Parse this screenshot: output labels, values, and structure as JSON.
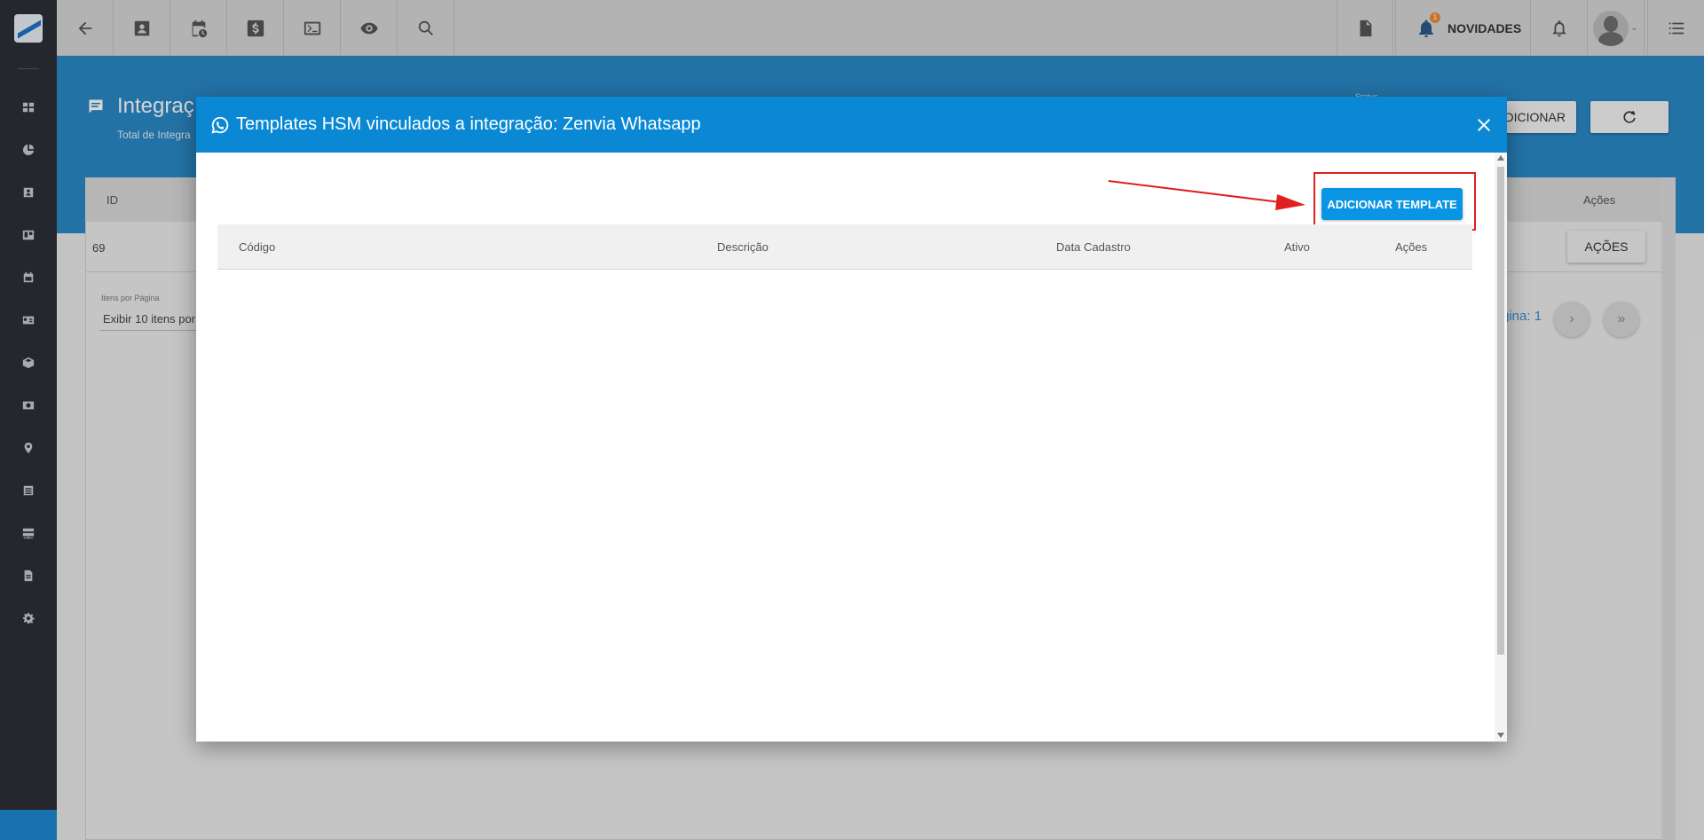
{
  "topbar": {
    "buttons": [
      "back-arrow-icon",
      "contact-card-icon",
      "calendar-clock-icon",
      "dollar-icon",
      "terminal-icon",
      "eye-icon",
      "search-icon"
    ],
    "right": {
      "novidades_label": "NOVIDADES",
      "badge_count": "1"
    }
  },
  "sidebar": {
    "items": [
      "dashboard-icon",
      "pie-chart-icon",
      "contact-icon",
      "board-icon",
      "calendar-icon",
      "id-card-icon",
      "box-icon",
      "money-icon",
      "location-icon",
      "list-icon",
      "server-icon",
      "document-icon",
      "settings-icon"
    ]
  },
  "page": {
    "title": "Integraç",
    "subtitle": "Total de Integra",
    "status_label": "Status",
    "add_button": "ADICIONAR",
    "table": {
      "col_id": "ID",
      "col_acoes": "Ações",
      "row_id": "69",
      "row_button": "AÇÕES"
    },
    "items_per_page_label": "Itens por Página",
    "items_per_page_value": "Exibir 10 itens por",
    "pagina": "gina: 1"
  },
  "modal": {
    "title": "Templates HSM vinculados a integração: Zenvia Whatsapp",
    "add_button": "ADICIONAR TEMPLATE",
    "columns": [
      "Código",
      "Descrição",
      "Data Cadastro",
      "Ativo",
      "Ações"
    ]
  },
  "colors": {
    "modal_header": "#0a88d4",
    "accent_button": "#0a95e4",
    "highlight": "#e02020",
    "sidebar": "#2b2f36"
  }
}
